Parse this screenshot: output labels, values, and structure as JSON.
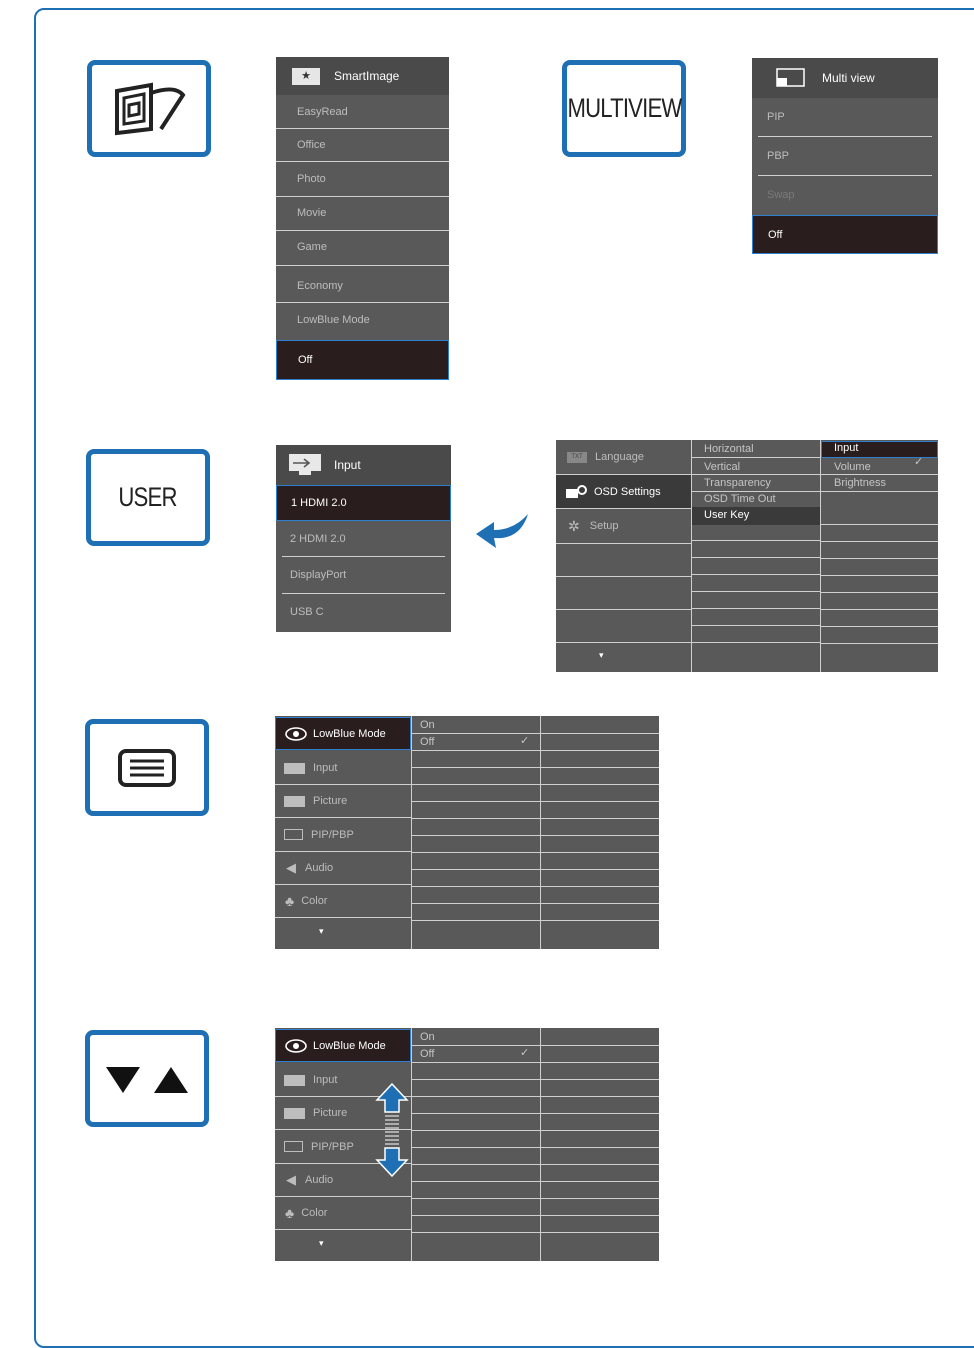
{
  "buttons": {
    "multiview_text": "MULTIVIEW",
    "user_text": "USER"
  },
  "smartimage": {
    "title": "SmartImage",
    "items": [
      "EasyRead",
      "Office",
      "Photo",
      "Movie",
      "Game",
      "Economy",
      "LowBlue Mode"
    ],
    "selected": "Off"
  },
  "multiview": {
    "title": "Multi view",
    "items": [
      "PIP",
      "PBP",
      "Swap"
    ],
    "selected": "Off"
  },
  "input_menu": {
    "title": "Input",
    "selected": "1 HDMI 2.0",
    "items": [
      "2 HDMI 2.0",
      "DisplayPort",
      "USB C"
    ]
  },
  "osd_menu": {
    "left_items": [
      "Language",
      "OSD Settings",
      "Setup"
    ],
    "lang_icon_text": "TXT",
    "mid_items": [
      "Horizontal",
      "Vertical",
      "Transparency",
      "OSD Time Out",
      "User Key"
    ],
    "right_items": [
      "Input",
      "Volume",
      "Brightness"
    ],
    "more_arrow": "▾"
  },
  "main_menu_1": {
    "left_items": [
      "LowBlue Mode",
      "Input",
      "Picture",
      "PIP/PBP",
      "Audio",
      "Color"
    ],
    "options": [
      "On",
      "Off"
    ],
    "more_arrow": "▾"
  },
  "main_menu_2": {
    "left_items": [
      "LowBlue Mode",
      "Input",
      "Picture",
      "PIP/PBP",
      "Audio",
      "Color"
    ],
    "options": [
      "On",
      "Off"
    ],
    "more_arrow": "▾"
  },
  "colors": {
    "accent": "#1f6fb5",
    "panel": "#595959",
    "selected_bg": "#2a1d1d",
    "selection_border": "#2e7fd0"
  }
}
